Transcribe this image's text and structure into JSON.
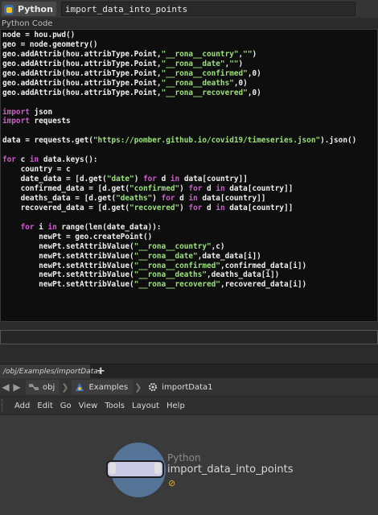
{
  "titlebar": {
    "type_label": "Python",
    "node_name": "import_data_into_points"
  },
  "section_label": "Python Code",
  "code_lines": [
    [
      {
        "t": "node = hou.pwd()"
      }
    ],
    [
      {
        "t": "geo = node.geometry()"
      }
    ],
    [
      {
        "t": "geo.addAttrib(hou.attribType.Point,"
      },
      {
        "t": "\"__rona__country\"",
        "c": "str"
      },
      {
        "t": ","
      },
      {
        "t": "\"\"",
        "c": "str"
      },
      {
        "t": ")"
      }
    ],
    [
      {
        "t": "geo.addAttrib(hou.attribType.Point,"
      },
      {
        "t": "\"__rona__date\"",
        "c": "str"
      },
      {
        "t": ","
      },
      {
        "t": "\"\"",
        "c": "str"
      },
      {
        "t": ")"
      }
    ],
    [
      {
        "t": "geo.addAttrib(hou.attribType.Point,"
      },
      {
        "t": "\"__rona__confirmed\"",
        "c": "str"
      },
      {
        "t": ",0)"
      }
    ],
    [
      {
        "t": "geo.addAttrib(hou.attribType.Point,"
      },
      {
        "t": "\"__rona__deaths\"",
        "c": "str"
      },
      {
        "t": ",0)"
      }
    ],
    [
      {
        "t": "geo.addAttrib(hou.attribType.Point,"
      },
      {
        "t": "\"__rona__recovered\"",
        "c": "str"
      },
      {
        "t": ",0)"
      }
    ],
    [
      {
        "t": ""
      }
    ],
    [
      {
        "t": "import",
        "c": "kw"
      },
      {
        "t": " json"
      }
    ],
    [
      {
        "t": "import",
        "c": "kw"
      },
      {
        "t": " requests"
      }
    ],
    [
      {
        "t": ""
      }
    ],
    [
      {
        "t": "data = requests.get("
      },
      {
        "t": "\"https://pomber.github.io/covid19/timeseries.json\"",
        "c": "str"
      },
      {
        "t": ").json()"
      }
    ],
    [
      {
        "t": ""
      }
    ],
    [
      {
        "t": "for",
        "c": "kw"
      },
      {
        "t": " c "
      },
      {
        "t": "in",
        "c": "kw"
      },
      {
        "t": " data.keys():"
      }
    ],
    [
      {
        "t": "    country = c"
      }
    ],
    [
      {
        "t": "    date_data = [d.get("
      },
      {
        "t": "\"date\"",
        "c": "str"
      },
      {
        "t": ") "
      },
      {
        "t": "for",
        "c": "kw"
      },
      {
        "t": " d "
      },
      {
        "t": "in",
        "c": "kw"
      },
      {
        "t": " data[country]]"
      }
    ],
    [
      {
        "t": "    confirmed_data = [d.get("
      },
      {
        "t": "\"confirmed\"",
        "c": "str"
      },
      {
        "t": ") "
      },
      {
        "t": "for",
        "c": "kw"
      },
      {
        "t": " d "
      },
      {
        "t": "in",
        "c": "kw"
      },
      {
        "t": " data[country]]"
      }
    ],
    [
      {
        "t": "    deaths_data = [d.get("
      },
      {
        "t": "\"deaths\"",
        "c": "str"
      },
      {
        "t": ") "
      },
      {
        "t": "for",
        "c": "kw"
      },
      {
        "t": " d "
      },
      {
        "t": "in",
        "c": "kw"
      },
      {
        "t": " data[country]]"
      }
    ],
    [
      {
        "t": "    recovered_data = [d.get("
      },
      {
        "t": "\"recovered\"",
        "c": "str"
      },
      {
        "t": ") "
      },
      {
        "t": "for",
        "c": "kw"
      },
      {
        "t": " d "
      },
      {
        "t": "in",
        "c": "kw"
      },
      {
        "t": " data[country]]"
      }
    ],
    [
      {
        "t": ""
      }
    ],
    [
      {
        "t": "    "
      },
      {
        "t": "for",
        "c": "kw"
      },
      {
        "t": " i "
      },
      {
        "t": "in",
        "c": "kw"
      },
      {
        "t": " range(len(date_data)):"
      }
    ],
    [
      {
        "t": "        newPt = geo.createPoint()"
      }
    ],
    [
      {
        "t": "        newPt.setAttribValue("
      },
      {
        "t": "\"__rona__country\"",
        "c": "str"
      },
      {
        "t": ",c)"
      }
    ],
    [
      {
        "t": "        newPt.setAttribValue("
      },
      {
        "t": "\"__rona__date\"",
        "c": "str"
      },
      {
        "t": ",date_data[i])"
      }
    ],
    [
      {
        "t": "        newPt.setAttribValue("
      },
      {
        "t": "\"__rona__confirmed\"",
        "c": "str"
      },
      {
        "t": ",confirmed_data[i])"
      }
    ],
    [
      {
        "t": "        newPt.setAttribValue("
      },
      {
        "t": "\"__rona__deaths\"",
        "c": "str"
      },
      {
        "t": ",deaths_data[i])"
      }
    ],
    [
      {
        "t": "        newPt.setAttribValue("
      },
      {
        "t": "\"__rona__recovered\"",
        "c": "str"
      },
      {
        "t": ",recovered_data[i])"
      }
    ]
  ],
  "network_tab": {
    "path_label": "/obj/Examples/importData1",
    "add_label": "+"
  },
  "breadcrumbs": [
    "obj",
    "Examples",
    "importData1"
  ],
  "menu": [
    "Add",
    "Edit",
    "Go",
    "View",
    "Tools",
    "Layout",
    "Help"
  ],
  "node": {
    "type_label": "Python",
    "name": "import_data_into_points",
    "warning_glyph": "⊘"
  },
  "colors": {
    "keyword": "#d05ad0",
    "string": "#9ce27c",
    "code_bg": "#0e0e0e"
  }
}
